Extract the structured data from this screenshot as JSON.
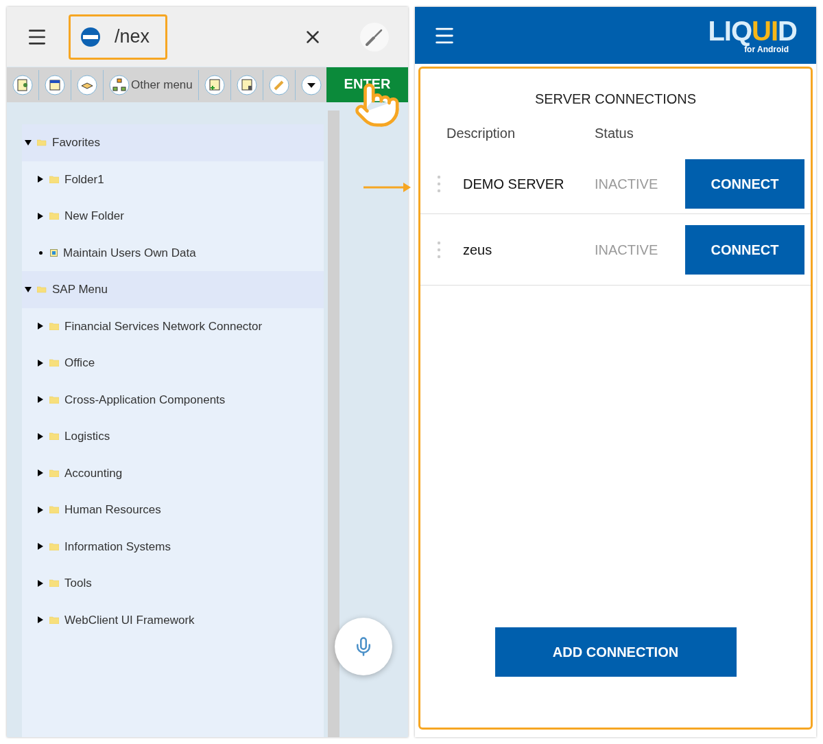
{
  "left_app": {
    "command_field": {
      "value": "/nex"
    },
    "toolbar": {
      "menu_label": "Other menu",
      "enter_label": "ENTER"
    },
    "tree": [
      {
        "label": "Favorites",
        "kind": "folder",
        "expanded": true,
        "children": [
          {
            "label": "Folder1",
            "kind": "folder",
            "expanded": false
          },
          {
            "label": "New Folder",
            "kind": "folder",
            "expanded": false
          },
          {
            "label": "Maintain Users Own Data",
            "kind": "transaction"
          }
        ]
      },
      {
        "label": "SAP Menu",
        "kind": "folder",
        "expanded": true,
        "children": [
          {
            "label": "Financial Services Network Connector",
            "kind": "folder",
            "expanded": false
          },
          {
            "label": "Office",
            "kind": "folder",
            "expanded": false
          },
          {
            "label": "Cross-Application Components",
            "kind": "folder",
            "expanded": false
          },
          {
            "label": "Logistics",
            "kind": "folder",
            "expanded": false
          },
          {
            "label": "Accounting",
            "kind": "folder",
            "expanded": false
          },
          {
            "label": "Human Resources",
            "kind": "folder",
            "expanded": false
          },
          {
            "label": "Information Systems",
            "kind": "folder",
            "expanded": false
          },
          {
            "label": "Tools",
            "kind": "folder",
            "expanded": false
          },
          {
            "label": "WebClient UI Framework",
            "kind": "folder",
            "expanded": false
          }
        ]
      }
    ]
  },
  "right_app": {
    "logo": {
      "word": "LIQ",
      "highlight": "UI",
      "end": "D",
      "sub": "for Android"
    },
    "title": "SERVER CONNECTIONS",
    "columns": [
      "Description",
      "Status"
    ],
    "connections": [
      {
        "description": "DEMO SERVER",
        "status": "INACTIVE",
        "action": "CONNECT"
      },
      {
        "description": "zeus",
        "status": "INACTIVE",
        "action": "CONNECT"
      }
    ],
    "add_button": "ADD CONNECTION"
  }
}
